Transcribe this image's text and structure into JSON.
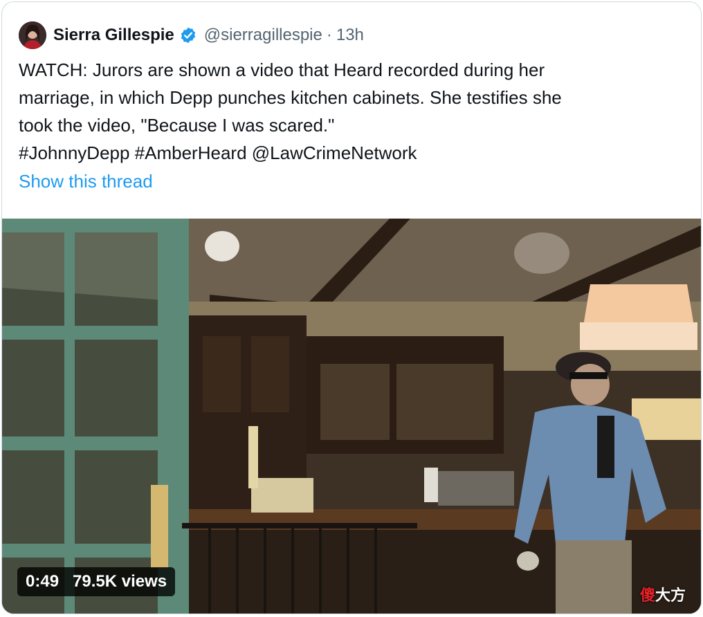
{
  "tweet": {
    "author_name": "Sierra Gillespie",
    "handle": "@sierragillespie",
    "separator": "·",
    "time": "13h",
    "text_lines": [
      "WATCH: Jurors are shown a video that Heard recorded during her",
      "marriage, in which Depp punches kitchen cabinets. She testifies she",
      "took the video, \"Because I was scared.\"",
      "#JohnnyDepp #AmberHeard @LawCrimeNetwork"
    ],
    "show_thread": "Show this thread"
  },
  "video": {
    "duration": "0:49",
    "views": "79.5K views",
    "watermark_red": "傻",
    "watermark_white": "大方"
  },
  "icons": {
    "verified": "verified-badge-icon"
  },
  "colors": {
    "link": "#1d9bf0",
    "verified": "#1d9bf0",
    "text": "#0f1419",
    "secondary": "#536471"
  }
}
